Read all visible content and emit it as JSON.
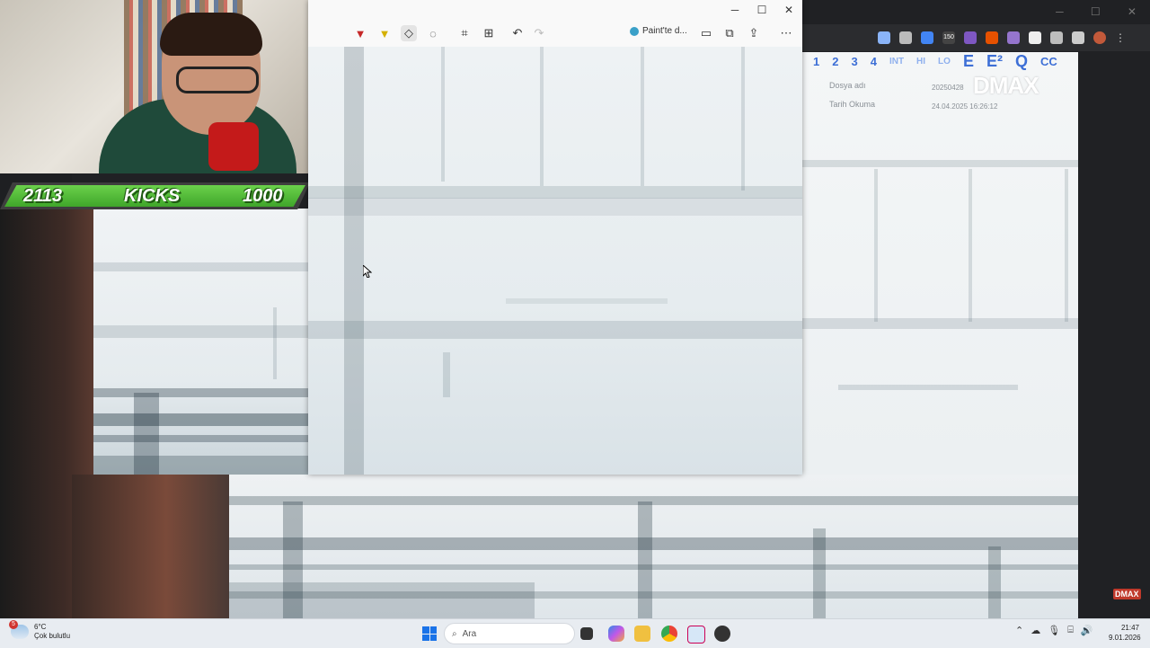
{
  "webcam": {
    "kicks": {
      "left_count": "2113",
      "label": "KICKS",
      "goal": "1000"
    }
  },
  "snipping_tool": {
    "window_controls": {
      "minimize": "─",
      "maximize": "☐",
      "close": "✕"
    },
    "toolbar": {
      "paint_label": "Paint'te d..."
    }
  },
  "xray_overlay": {
    "keypad": [
      "1",
      "2",
      "3",
      "4",
      "INT",
      "HI",
      "LO",
      "E",
      "E²",
      "Q",
      "CC"
    ],
    "meta_labels": [
      "Dosya adı",
      "Tarih Okuma"
    ],
    "meta_values": [
      "20250428",
      "24.04.2025 16:26:12"
    ],
    "brand": "DMAX",
    "brand_small": "DMAX"
  },
  "taskbar": {
    "weather": {
      "badge": "5",
      "temp": "6°C",
      "condition": "Çok bulutlu"
    },
    "search_placeholder": "Ara",
    "clock": {
      "time": "21:47",
      "date": "9.01.2026"
    }
  },
  "browser": {
    "extension_badge": "150"
  }
}
